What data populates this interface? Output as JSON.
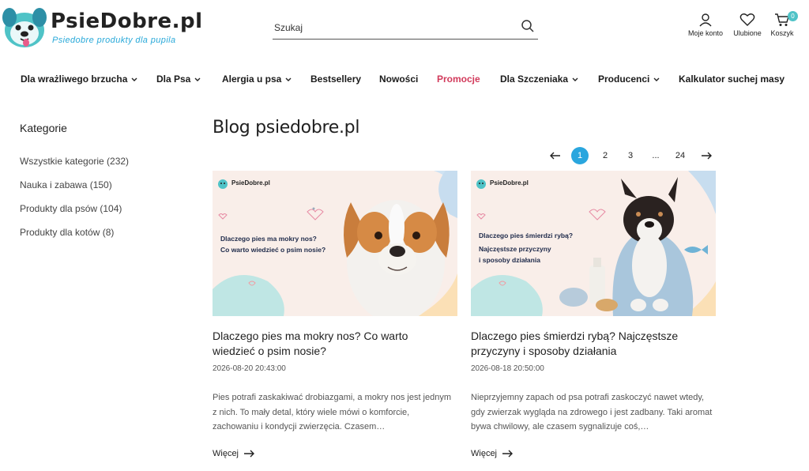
{
  "brand": {
    "name": "PsieDobre.pl",
    "tagline": "Psiedobre produkty dla pupila"
  },
  "search": {
    "placeholder": "Szukaj",
    "icon": "search-icon"
  },
  "header_actions": [
    {
      "label": "Moje konto",
      "icon": "user-icon"
    },
    {
      "label": "Ulubione",
      "icon": "heart-icon"
    },
    {
      "label": "Koszyk",
      "icon": "cart-icon",
      "badge": "0"
    }
  ],
  "nav": [
    {
      "label": "Dla wrażliwego brzucha",
      "dropdown": true
    },
    {
      "label": "Dla Psa",
      "dropdown": true
    },
    {
      "label": "Alergia u psa",
      "dropdown": true
    },
    {
      "label": "Bestsellery",
      "dropdown": false
    },
    {
      "label": "Nowości",
      "dropdown": false
    },
    {
      "label": "Promocje",
      "dropdown": false,
      "highlight": "#d23a5b"
    },
    {
      "label": "Dla Szczeniaka",
      "dropdown": true
    },
    {
      "label": "Producenci",
      "dropdown": true
    },
    {
      "label": "Kalkulator suchej masy",
      "dropdown": false
    }
  ],
  "sidebar": {
    "title": "Kategorie",
    "categories": [
      {
        "label": "Wszystkie kategorie (232)"
      },
      {
        "label": "Nauka i zabawa (150)"
      },
      {
        "label": "Produkty dla psów (104)"
      },
      {
        "label": "Produkty dla kotów (8)"
      }
    ]
  },
  "main": {
    "title": "Blog psiedobre.pl"
  },
  "pagination": {
    "prev_icon": "arrow-left-icon",
    "next_icon": "arrow-right-icon",
    "pages": [
      "1",
      "2",
      "3",
      "...",
      "24"
    ],
    "current": "1",
    "accent": "#2aa6de"
  },
  "posts": [
    {
      "title": "Dlaczego pies ma mokry nos? Co warto wiedzieć o psim nosie?",
      "date": "2026-08-20 20:43:00",
      "excerpt": "Pies potrafi zaskakiwać drobiazgami, a mokry nos jest jednym z nich. To mały detal, który wiele mówi o komforcie, zachowaniu i kondycji zwierzęcia. Czasem…",
      "more": "Więcej",
      "image": {
        "logo_text": "PsieDobre.pl",
        "line1": "Dlaczego pies ma mokry nos?",
        "line2": "Co warto wiedzieć o psim nosie?"
      }
    },
    {
      "title": "Dlaczego pies śmierdzi rybą? Najczęstsze przyczyny i sposoby działania",
      "date": "2026-08-18 20:50:00",
      "excerpt": "Nieprzyjemny zapach od psa potrafi zaskoczyć nawet wtedy, gdy zwierzak wygląda na zdrowego i jest zadbany. Taki aromat bywa chwilowy, ale czasem sygnalizuje coś,…",
      "more": "Więcej",
      "image": {
        "logo_text": "PsieDobre.pl",
        "line1": "Dlaczego pies śmierdzi rybą?",
        "line2": "Najczęstsze przyczyny",
        "line3": "i sposoby działania"
      }
    }
  ]
}
